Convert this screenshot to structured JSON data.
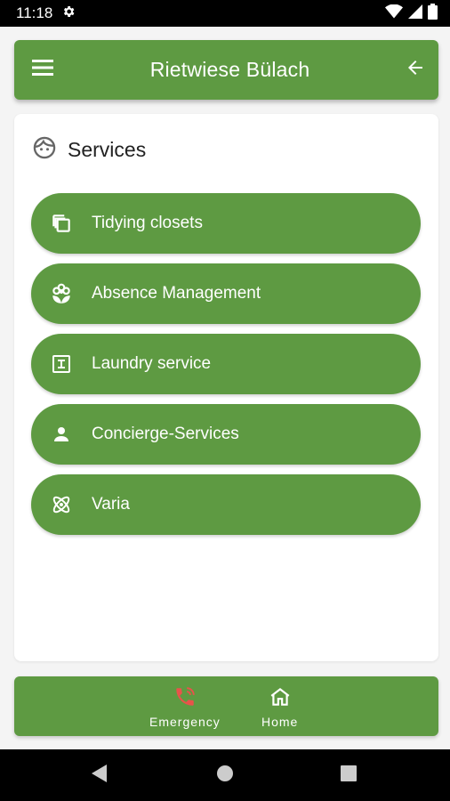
{
  "status_bar": {
    "time": "11:18"
  },
  "app_bar": {
    "title": "Rietwiese Bülach"
  },
  "card": {
    "heading": "Services",
    "items": [
      {
        "label": "Tidying closets",
        "icon": "copy-icon"
      },
      {
        "label": "Absence Management",
        "icon": "flower-icon"
      },
      {
        "label": "Laundry service",
        "icon": "text-box-icon"
      },
      {
        "label": "Concierge-Services",
        "icon": "person-icon"
      },
      {
        "label": "Varia",
        "icon": "atom-icon"
      }
    ]
  },
  "bottom_nav": {
    "emergency_label": "Emergency",
    "home_label": "Home"
  },
  "colors": {
    "brand_green": "#5e9a42",
    "emergency_red": "#e8534a"
  }
}
